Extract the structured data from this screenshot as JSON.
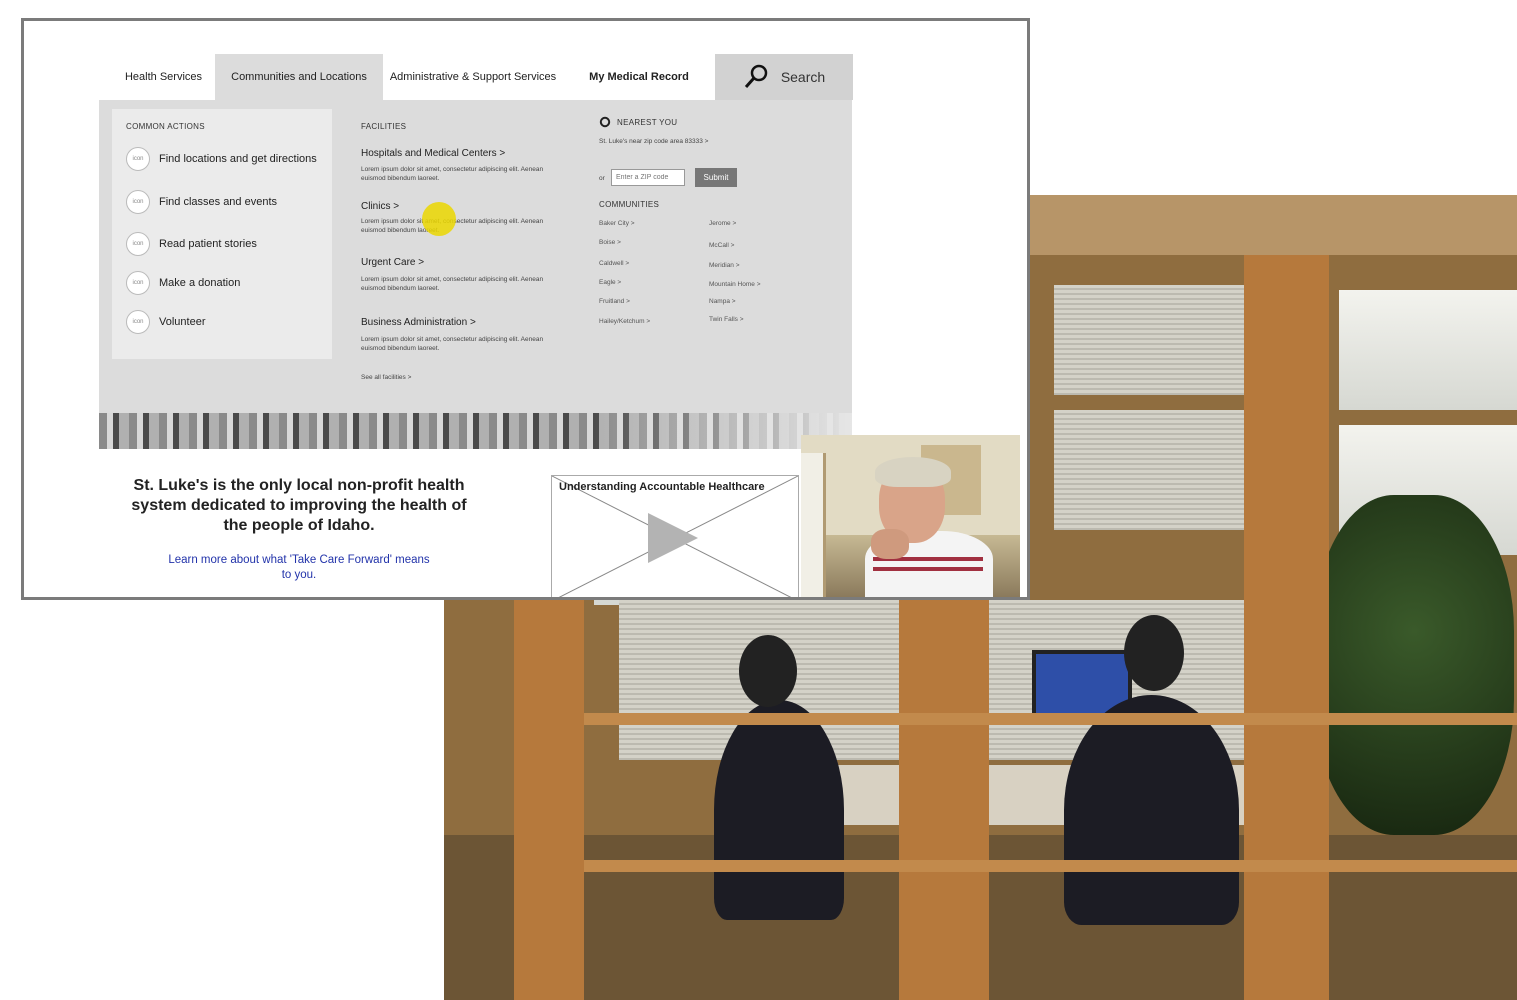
{
  "nav": {
    "tabs": [
      {
        "label": "Health Services"
      },
      {
        "label": "Communities and Locations"
      },
      {
        "label": "Administrative & Support Services"
      },
      {
        "label": "My Medical Record"
      }
    ],
    "search_label": "Search"
  },
  "mega_menu": {
    "common_actions": {
      "heading": "COMMON ACTIONS",
      "icon_placeholder": "icon",
      "items": [
        {
          "label": "Find locations and get directions"
        },
        {
          "label": "Find classes and events"
        },
        {
          "label": "Read patient stories"
        },
        {
          "label": "Make a donation"
        },
        {
          "label": "Volunteer"
        }
      ]
    },
    "facilities": {
      "heading": "FACILITIES",
      "items": [
        {
          "title": "Hospitals and Medical Centers >",
          "desc": "Lorem ipsum dolor sit amet, consectetur adipiscing elit. Aenean euismod bibendum laoreet."
        },
        {
          "title": "Clinics >",
          "desc": "Lorem ipsum dolor sit amet, consectetur adipiscing elit. Aenean euismod bibendum laoreet."
        },
        {
          "title": "Urgent Care >",
          "desc": "Lorem ipsum dolor sit amet, consectetur adipiscing elit. Aenean euismod bibendum laoreet."
        },
        {
          "title": "Business Administration >",
          "desc": "Lorem ipsum dolor sit amet, consectetur adipiscing elit. Aenean euismod bibendum laoreet."
        }
      ],
      "see_all": "See all facilities >"
    },
    "nearest": {
      "heading": "NEAREST YOU",
      "zip_link": "St. Luke's near zip code area 83333 >",
      "or_label": "or",
      "zip_placeholder": "Enter a ZIP code",
      "submit_label": "Submit"
    },
    "communities": {
      "heading": "COMMUNITIES",
      "left": [
        "Baker City >",
        "Boise >",
        "Caldwell >",
        "Eagle >",
        "Fruitland >",
        "Hailey/Ketchum >"
      ],
      "right": [
        "Jerome >",
        "McCall >",
        "Meridian >",
        "Mountain Home >",
        "Nampa >",
        "Twin Falls >"
      ]
    }
  },
  "content": {
    "tagline": "St. Luke's is the only local non-profit health system dedicated to improving the health of the people of Idaho.",
    "learn_more": "Learn more about what 'Take Care Forward' means to you.",
    "video_title": "Understanding Accountable Healthcare"
  },
  "colors": {
    "menu_bg": "#dcdcdc",
    "actions_bg": "#ebebeb",
    "link_blue": "#2233aa",
    "cursor_highlight": "#ebd700"
  }
}
